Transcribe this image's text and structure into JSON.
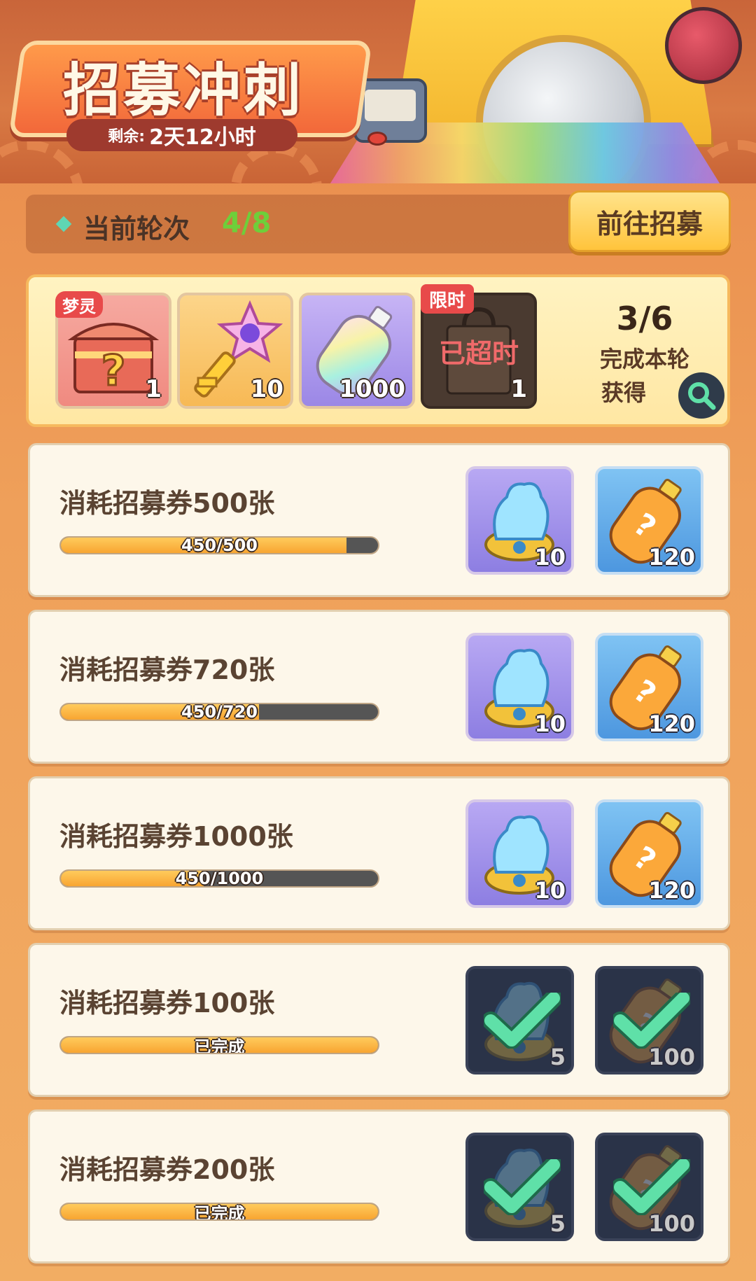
{
  "event": {
    "title": "招募冲刺",
    "remaining_label": "剩余:",
    "remaining_value": "2天12小时"
  },
  "round": {
    "label": "当前轮次",
    "value": "4/8",
    "goto_button": "前往招募"
  },
  "round_rewards": {
    "items": [
      {
        "icon": "mystery-chest-icon",
        "tag": "梦灵",
        "count": "1"
      },
      {
        "icon": "star-key-icon",
        "count": "10"
      },
      {
        "icon": "rainbow-bottle-icon",
        "count": "1000"
      },
      {
        "icon": "gift-bag-icon",
        "tag": "限时",
        "status": "已超时",
        "count": "1"
      }
    ],
    "progress": "3/6",
    "complete_label": "完成本轮",
    "obtain_label": "获得"
  },
  "tasks": [
    {
      "title": "消耗招募券500张",
      "progress_text": "450/500",
      "progress": 0.9,
      "reward1_count": "10",
      "reward2_count": "120",
      "done": false
    },
    {
      "title": "消耗招募券720张",
      "progress_text": "450/720",
      "progress": 0.625,
      "reward1_count": "10",
      "reward2_count": "120",
      "done": false
    },
    {
      "title": "消耗招募券1000张",
      "progress_text": "450/1000",
      "progress": 0.45,
      "reward1_count": "10",
      "reward2_count": "120",
      "done": false
    },
    {
      "title": "消耗招募券100张",
      "progress_text": "已完成",
      "progress": 1.0,
      "reward1_count": "5",
      "reward2_count": "100",
      "done": true
    },
    {
      "title": "消耗招募券200张",
      "progress_text": "已完成",
      "progress": 1.0,
      "reward1_count": "5",
      "reward2_count": "100",
      "done": true
    }
  ],
  "colors": {
    "accent_green": "#6ecf3a",
    "progress_fill": "#f8a531",
    "check_green": "#5fe0a8",
    "limit_red": "#e84a4a"
  }
}
